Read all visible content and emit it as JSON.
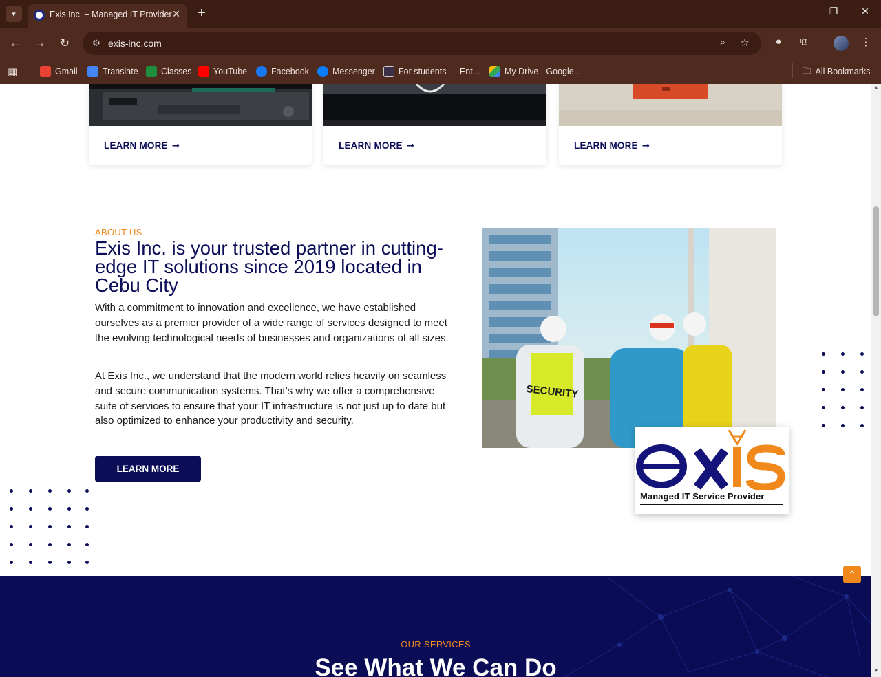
{
  "browser": {
    "tab_title": "Exis Inc. – Managed IT Provider",
    "url": "exis-inc.com",
    "bookmarks": [
      {
        "label": "Gmail",
        "color": "#ea4335"
      },
      {
        "label": "Translate",
        "color": "#4285f4"
      },
      {
        "label": "Classes",
        "color": "#1e8e3e"
      },
      {
        "label": "YouTube",
        "color": "#ff0000"
      },
      {
        "label": "Facebook",
        "color": "#1877f2"
      },
      {
        "label": "Messenger",
        "color": "#0a7cff"
      },
      {
        "label": "For students — Ent...",
        "color": "#3b2f4a"
      },
      {
        "label": "My Drive - Google...",
        "color": "#fbbc04"
      }
    ],
    "all_bookmarks": "All Bookmarks"
  },
  "cards": [
    {
      "link": "LEARN MORE"
    },
    {
      "link": "LEARN MORE"
    },
    {
      "link": "LEARN MORE"
    }
  ],
  "about": {
    "label": "ABOUT US",
    "title": "Exis Inc. is your trusted partner in cutting-edge IT solutions since 2019 located in Cebu City",
    "p1": "With a commitment to innovation and excellence, we have established ourselves as a premier provider of a wide range of services designed to meet the evolving technological needs of businesses and organizations of all sizes.",
    "p2": "At Exis Inc., we understand that the modern world relies heavily on seamless and secure communication systems. That’s why we offer a comprehensive suite of services to ensure that your IT infrastructure is not just up to date but also optimized to enhance your productivity and security.",
    "button": "LEARN MORE",
    "photo_vest_text": "SECURITY"
  },
  "logo": {
    "wordmark": "exis",
    "tagline": "Managed IT Service Provider"
  },
  "services": {
    "label": "OUR SERVICES",
    "title": "See What We Can Do"
  },
  "colors": {
    "brand_navy": "#0b0d57",
    "accent_orange": "#f0881c",
    "chrome_brown": "#4f2b1f"
  }
}
